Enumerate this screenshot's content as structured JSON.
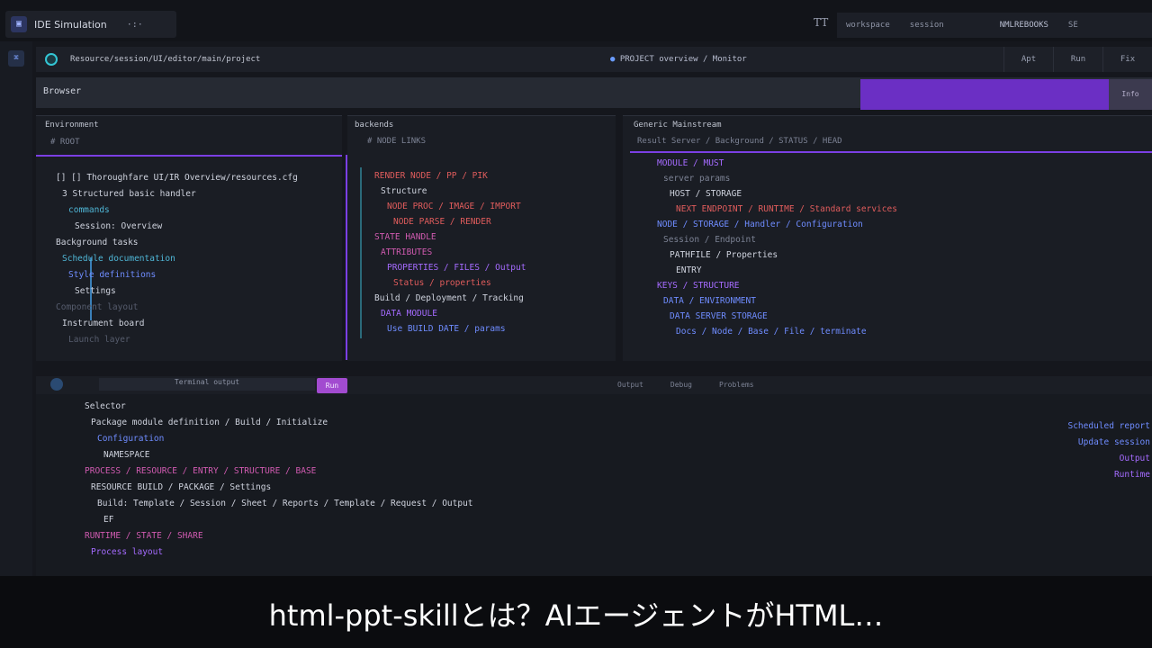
{
  "window": {
    "title": "IDE Simulation",
    "menu_dots": "·:·"
  },
  "top_right": {
    "tabs": [
      "workspace",
      "session",
      "NMLREBOOKS",
      "SE"
    ]
  },
  "tt_icon": "TT",
  "address": {
    "url": "Resource/session/UI/editor/main/project",
    "mid": "PROJECT overview / Monitor",
    "buttons": [
      "Apt",
      "Run",
      "Fix"
    ]
  },
  "section": {
    "title": "Browser",
    "tail": "Info"
  },
  "panes": {
    "left": {
      "title": "Environment",
      "sub": "# ROOT",
      "lines": [
        {
          "t": "[] [] Thoroughfare UI/IR Overview/resources.cfg",
          "c": "c-white"
        },
        {
          "t": "3 Structured basic handler",
          "c": "c-white"
        },
        {
          "t": "commands",
          "c": "c-cyan"
        },
        {
          "t": "Session: Overview",
          "c": "c-white"
        },
        {
          "t": "Background tasks",
          "c": "c-white"
        },
        {
          "t": "Schedule documentation",
          "c": "c-cyan"
        },
        {
          "t": "Style definitions",
          "c": "c-blue"
        },
        {
          "t": "Settings",
          "c": "c-white"
        },
        {
          "t": "Component layout",
          "c": "c-dim"
        },
        {
          "t": "Instrument board",
          "c": "c-white"
        },
        {
          "t": "Launch layer",
          "c": "c-dim"
        }
      ]
    },
    "middle": {
      "title": "backends",
      "sub": "# NODE LINKS",
      "lines": [
        {
          "t": "RENDER NODE / PP / PIK",
          "c": "c-red"
        },
        {
          "t": "Structure",
          "c": "c-white"
        },
        {
          "t": "NODE PROC / IMAGE / IMPORT",
          "c": "c-red"
        },
        {
          "t": "NODE PARSE / RENDER",
          "c": "c-red"
        },
        {
          "t": "STATE HANDLE",
          "c": "c-pink"
        },
        {
          "t": "ATTRIBUTES",
          "c": "c-pink"
        },
        {
          "t": "PROPERTIES / FILES / Output",
          "c": "c-violet"
        },
        {
          "t": "Status / properties",
          "c": "c-red"
        },
        {
          "t": "Build / Deployment / Tracking",
          "c": "c-white"
        },
        {
          "t": "DATA MODULE",
          "c": "c-violet"
        },
        {
          "t": "Use BUILD DATE / params",
          "c": "c-blue"
        }
      ]
    },
    "right": {
      "title": "Generic Mainstream",
      "sub": "Result Server / Background / STATUS / HEAD",
      "lines": [
        {
          "t": "MODULE / MUST",
          "c": "c-violet"
        },
        {
          "t": "server params",
          "c": "c-grey"
        },
        {
          "t": "HOST / STORAGE",
          "c": "c-white"
        },
        {
          "t": "NEXT ENDPOINT / RUNTIME / Standard services",
          "c": "c-red"
        },
        {
          "t": "NODE / STORAGE / Handler / Configuration",
          "c": "c-blue"
        },
        {
          "t": "Session / Endpoint",
          "c": "c-grey"
        },
        {
          "t": "PATHFILE / Properties",
          "c": "c-white"
        },
        {
          "t": "ENTRY",
          "c": "c-white"
        },
        {
          "t": "KEYS / STRUCTURE",
          "c": "c-violet"
        },
        {
          "t": "DATA / ENVIRONMENT",
          "c": "c-blue"
        },
        {
          "t": "DATA SERVER STORAGE",
          "c": "c-blue"
        },
        {
          "t": "Docs / Node / Base / File / terminate",
          "c": "c-blue"
        }
      ]
    }
  },
  "bottom": {
    "tabs": [
      "Terminal output",
      "Run",
      "Output",
      "Debug",
      "Problems"
    ],
    "lines": [
      {
        "t": "Selector",
        "c": "c-white"
      },
      {
        "t": "Package module definition / Build / Initialize",
        "c": "c-white"
      },
      {
        "t": "Configuration",
        "c": "c-blue"
      },
      {
        "t": "NAMESPACE",
        "c": "c-white"
      },
      {
        "t": "PROCESS / RESOURCE / ENTRY / STRUCTURE / BASE",
        "c": "c-pink"
      },
      {
        "t": "RESOURCE BUILD / PACKAGE / Settings",
        "c": "c-white"
      },
      {
        "t": "Build: Template / Session / Sheet / Reports / Template / Request / Output",
        "c": "c-white"
      },
      {
        "t": "EF",
        "c": "c-white"
      },
      {
        "t": "RUNTIME / STATE / SHARE",
        "c": "c-pink"
      },
      {
        "t": "Process layout",
        "c": "c-violet"
      }
    ],
    "right_lines": [
      {
        "t": "Scheduled report",
        "c": "c-blue"
      },
      {
        "t": "Update session",
        "c": "c-blue"
      },
      {
        "t": "Output",
        "c": "c-violet"
      },
      {
        "t": "Runtime",
        "c": "c-violet"
      }
    ]
  },
  "subtitle": "html-ppt-skillとは？AIエージェントがHTML…"
}
